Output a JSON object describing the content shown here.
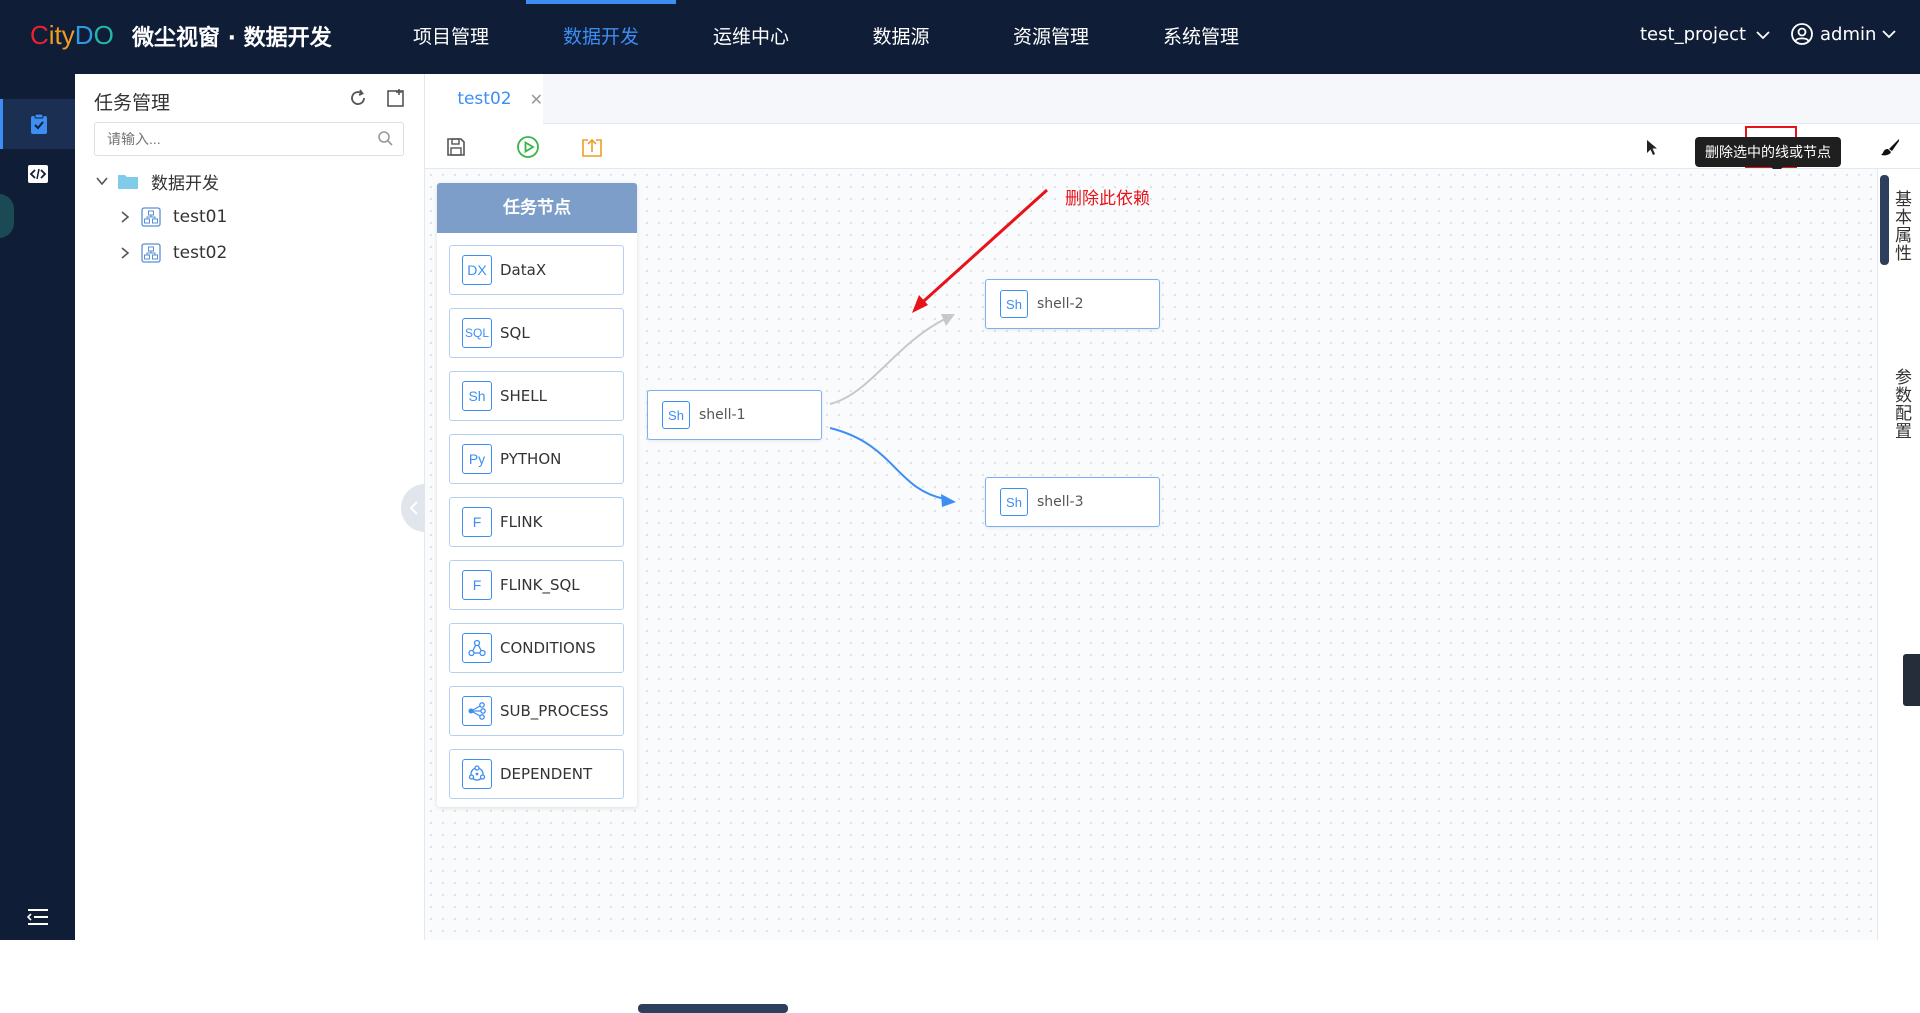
{
  "header": {
    "logo_parts": [
      "C",
      "ity",
      "D",
      "O"
    ],
    "brand": "微尘视窗 · 数据开发",
    "nav": [
      "项目管理",
      "数据开发",
      "运维中心",
      "数据源",
      "资源管理",
      "系统管理"
    ],
    "active_nav": "数据开发",
    "project": "test_project",
    "user": "admin"
  },
  "tree_panel": {
    "title": "任务管理",
    "search_placeholder": "请输入...",
    "root": "数据开发",
    "children": [
      "test01",
      "test02"
    ]
  },
  "editor": {
    "tab_label": "test02",
    "tooltip": "删除选中的线或节点",
    "annotation": "删除此依赖",
    "node_panel_title": "任务节点",
    "node_types": [
      {
        "icon": "DX",
        "label": "DataX"
      },
      {
        "icon": "SQL",
        "label": "SQL"
      },
      {
        "icon": "Sh",
        "label": "SHELL"
      },
      {
        "icon": "Py",
        "label": "PYTHON"
      },
      {
        "icon": "F",
        "label": "FLINK"
      },
      {
        "icon": "F",
        "label": "FLINK_SQL"
      },
      {
        "icon": "conditions-icon",
        "label": "CONDITIONS"
      },
      {
        "icon": "subprocess-icon",
        "label": "SUB_PROCESS"
      },
      {
        "icon": "dependent-icon",
        "label": "DEPENDENT"
      }
    ],
    "flow_nodes": [
      {
        "icon": "Sh",
        "label": "shell-1"
      },
      {
        "icon": "Sh",
        "label": "shell-2"
      },
      {
        "icon": "Sh",
        "label": "shell-3"
      }
    ]
  },
  "right_panel": {
    "tabs": [
      "基本属性",
      "参数配置"
    ]
  },
  "colors": {
    "accent": "#3d8ef2",
    "topbar": "#0f1d37",
    "danger": "#e8131a"
  }
}
